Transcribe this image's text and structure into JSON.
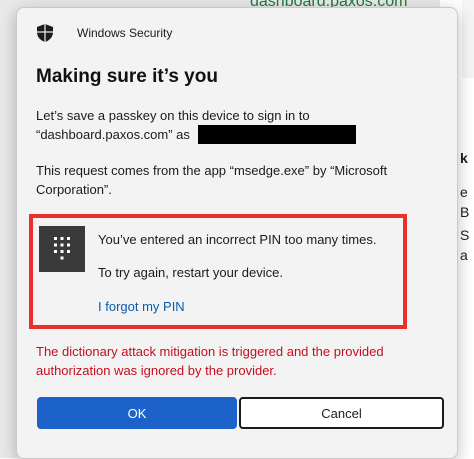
{
  "background": {
    "url_fragment": "dashboard.paxos.com",
    "side_letters": [
      "k",
      "e",
      "B",
      "S",
      "a"
    ]
  },
  "dialog": {
    "app_name": "Windows Security",
    "app_icon": "shield-icon",
    "heading": "Making sure it’s you",
    "passkey_text": "Let’s save a passkey on this device to sign in to “dashboard.paxos.com” as",
    "request_text": "This request comes from the app “msedge.exe” by “Microsoft Corporation”.",
    "pin_box": {
      "icon": "keypad-icon",
      "message_1": "You’ve entered an incorrect PIN too many times.",
      "message_2": "To try again, restart your device.",
      "forgot_link": "I forgot my PIN"
    },
    "error_text": "The dictionary attack mitigation is triggered and the provided authorization was ignored by the provider.",
    "ok_label": "OK",
    "cancel_label": "Cancel"
  },
  "colors": {
    "primary_button": "#1d62c9",
    "error_text": "#c50f1f",
    "highlight_border": "#e8302c",
    "link": "#0b5cad"
  }
}
